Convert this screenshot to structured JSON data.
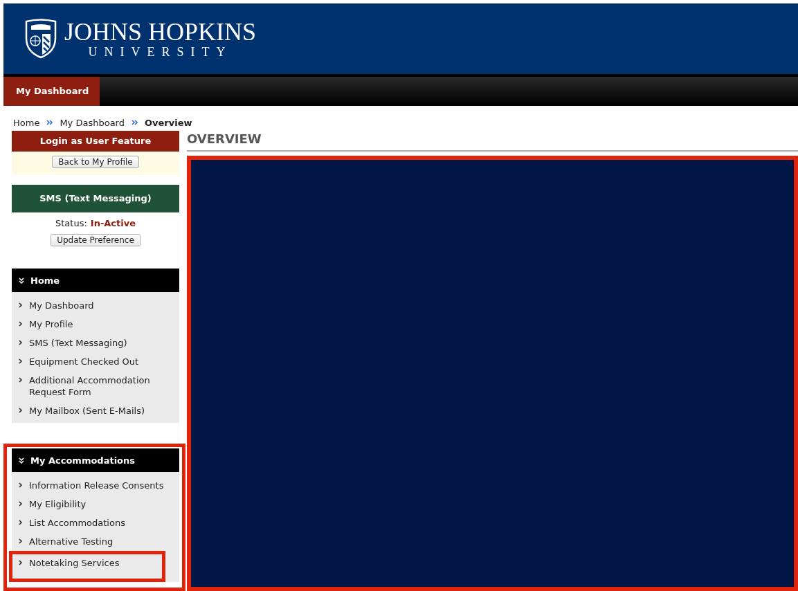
{
  "header": {
    "logo_name": "JOHNS HOPKINS",
    "logo_sub": "UNIVERSITY"
  },
  "nav": {
    "tabs": [
      {
        "label": "My Dashboard",
        "selected": true
      }
    ]
  },
  "breadcrumb": [
    {
      "label": "Home",
      "current": false
    },
    {
      "label": "My Dashboard",
      "current": false
    },
    {
      "label": "Overview",
      "current": true
    }
  ],
  "sidebar": {
    "login_panel": {
      "title": "Login as User Feature",
      "button": "Back to My Profile"
    },
    "sms_panel": {
      "title": "SMS (Text Messaging)",
      "status_label": "Status:",
      "status_value": "In-Active",
      "button": "Update Preference"
    },
    "menus": [
      {
        "title": "Home",
        "expanded": true,
        "highlighted": false,
        "items": [
          {
            "label": "My Dashboard",
            "highlighted": false
          },
          {
            "label": "My Profile",
            "highlighted": false
          },
          {
            "label": "SMS (Text Messaging)",
            "highlighted": false
          },
          {
            "label": "Equipment Checked Out",
            "highlighted": false
          },
          {
            "label": "Additional Accommodation Request Form",
            "highlighted": false
          },
          {
            "label": "My Mailbox (Sent E-Mails)",
            "highlighted": false
          }
        ]
      },
      {
        "title": "My Accommodations",
        "expanded": true,
        "highlighted": true,
        "items": [
          {
            "label": "Information Release Consents",
            "highlighted": false
          },
          {
            "label": "My Eligibility",
            "highlighted": false
          },
          {
            "label": "List Accommodations",
            "highlighted": false
          },
          {
            "label": "Alternative Testing",
            "highlighted": false
          },
          {
            "label": "Notetaking Services",
            "highlighted": true
          }
        ]
      }
    ]
  },
  "main": {
    "title": "OVERVIEW",
    "content_panel": {
      "highlighted": true
    }
  }
}
